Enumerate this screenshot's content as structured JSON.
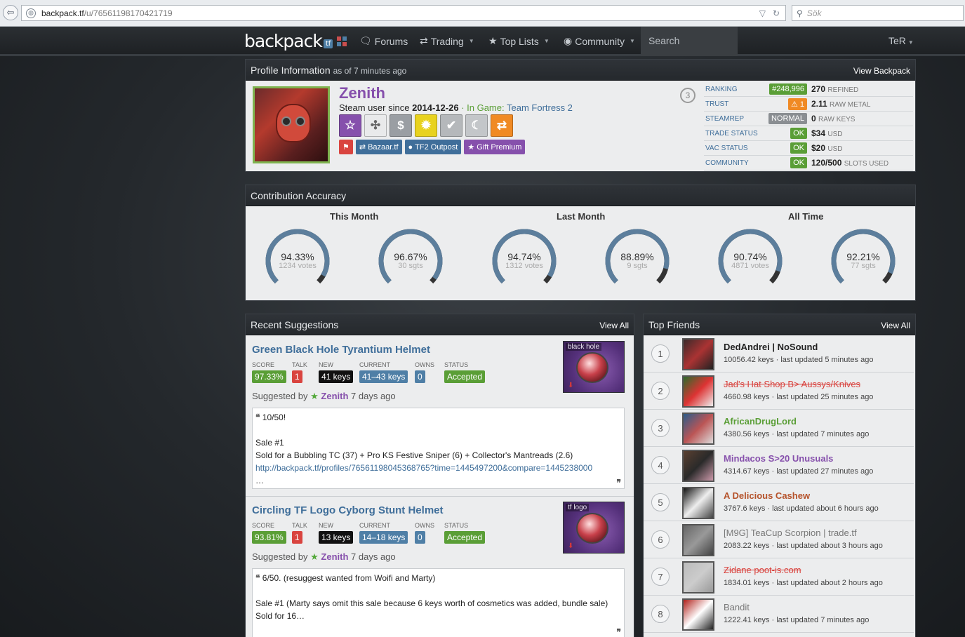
{
  "browser": {
    "url_host": "backpack.tf",
    "url_path": "/u/76561198170421719",
    "search_placeholder": "Sök"
  },
  "nav": {
    "logo": "backpack",
    "logo_badge": "tf",
    "items": [
      {
        "label": "Forums",
        "icon": "comments-icon"
      },
      {
        "label": "Trading",
        "icon": "exchange-icon"
      },
      {
        "label": "Top Lists",
        "icon": "star-icon"
      },
      {
        "label": "Community",
        "icon": "globe-icon"
      }
    ],
    "search": "Search",
    "user": "TeR"
  },
  "profile": {
    "header": "Profile Information",
    "header_sub": "as of 7 minutes ago",
    "view_backpack": "View Backpack",
    "name": "Zenith",
    "since_label": "Steam user since",
    "since_date": "2014-12-26",
    "in_game_label": "· In Game:",
    "game": "Team Fortress 2",
    "badges": [
      {
        "icon": "star-outline-icon",
        "color": "#8650ac",
        "glyph": "☆"
      },
      {
        "icon": "crosshair-icon",
        "color": "#e9eaeb",
        "glyph": "✣"
      },
      {
        "icon": "dollar-icon",
        "color": "#9a9ea3",
        "glyph": "$"
      },
      {
        "icon": "sun-icon",
        "color": "#e8d21f",
        "glyph": "✹"
      },
      {
        "icon": "check-icon",
        "color": "#b5b8bb",
        "glyph": "✔"
      },
      {
        "icon": "moon-icon",
        "color": "#c3c6c9",
        "glyph": "☾"
      },
      {
        "icon": "exchange-icon",
        "color": "#f08a24",
        "glyph": "⇄"
      }
    ],
    "tags": [
      {
        "label": "",
        "icon": "flag-icon",
        "glyph": "⚑",
        "color": "#d9443f"
      },
      {
        "label": "Bazaar.tf",
        "icon": "exchange-icon",
        "glyph": "⇄",
        "color": "#3f6e9a"
      },
      {
        "label": "TF2 Outpost",
        "icon": "circle-icon",
        "glyph": "●",
        "color": "#3f6e9a"
      },
      {
        "label": "Gift Premium",
        "icon": "star-icon",
        "glyph": "★",
        "color": "#8650ac"
      }
    ],
    "rank_circle": "3",
    "stats": [
      {
        "label": "Ranking",
        "badge": "#248,996",
        "badge_color": "#5a9e36",
        "value": "270",
        "unit": "Refined"
      },
      {
        "label": "Trust",
        "badge": "⚠ 1",
        "badge_color": "#f08a24",
        "value": "2.11",
        "unit": "Raw Metal"
      },
      {
        "label": "SteamRep",
        "badge": "NORMAL",
        "badge_color": "#8a8e92",
        "value": "0",
        "unit": "Raw Keys"
      },
      {
        "label": "Trade Status",
        "badge": "OK",
        "badge_color": "#5a9e36",
        "value": "$34",
        "unit": "USD"
      },
      {
        "label": "VAC Status",
        "badge": "OK",
        "badge_color": "#5a9e36",
        "value": "$20",
        "unit": "USD"
      },
      {
        "label": "Community",
        "badge": "OK",
        "badge_color": "#5a9e36",
        "value": "120/500",
        "unit": "Slots Used"
      }
    ]
  },
  "contribution": {
    "header": "Contribution Accuracy",
    "columns": [
      "This Month",
      "Last Month",
      "All Time"
    ],
    "gauges": [
      {
        "pct": "94.33%",
        "value": 94.33,
        "votes": "1234 votes"
      },
      {
        "pct": "96.67%",
        "value": 96.67,
        "votes": "30 sgts"
      },
      {
        "pct": "94.74%",
        "value": 94.74,
        "votes": "1312 votes"
      },
      {
        "pct": "88.89%",
        "value": 88.89,
        "votes": "9 sgts"
      },
      {
        "pct": "90.74%",
        "value": 90.74,
        "votes": "4871 votes"
      },
      {
        "pct": "92.21%",
        "value": 92.21,
        "votes": "77 sgts"
      }
    ]
  },
  "suggestions": {
    "header": "Recent Suggestions",
    "view_all": "View All",
    "meta_headers": [
      "Score",
      "Talk",
      "New",
      "Current",
      "Owns",
      "Status"
    ],
    "suggested_by": "Suggested by",
    "items": [
      {
        "title": "Green Black Hole Tyrantium Helmet",
        "score": "97.33%",
        "talk": "1",
        "new": "41 keys",
        "current": "41–43 keys",
        "owns": "0",
        "status": "Accepted",
        "user": "Zenith",
        "when": "7 days ago",
        "thumb_label": "black hole",
        "quote": [
          "10/50!",
          "",
          "Sale #1",
          "Sold for a Bubbling TC (37) + Pro KS Festive Sniper (6) + Collector's Mantreads (2.6)"
        ],
        "quote_url": "http://backpack.tf/profiles/76561198045368765?time=1445497200&compare=1445238000",
        "quote_more": "…"
      },
      {
        "title": "Circling TF Logo Cyborg Stunt Helmet",
        "score": "93.81%",
        "talk": "1",
        "new": "13 keys",
        "current": "14–18 keys",
        "owns": "0",
        "status": "Accepted",
        "user": "Zenith",
        "when": "7 days ago",
        "thumb_label": "tf logo",
        "quote": [
          "6/50. (resuggest wanted from Woifi and Marty)",
          "",
          "Sale #1 (Marty says omit this sale because 6 keys worth of cosmetics was added, bundle sale)",
          "Sold for 16…"
        ],
        "quote_url": "",
        "quote_more": ""
      }
    ]
  },
  "friends": {
    "header": "Top Friends",
    "view_all": "View All",
    "items": [
      {
        "rank": "1",
        "name": "DedAndrei | NoSound",
        "color": "#222",
        "strike": false,
        "keys": "10056.42 keys",
        "updated": "last updated 5 minutes ago",
        "av": [
          "#3b2a2a",
          "#a33",
          "#222"
        ]
      },
      {
        "rank": "2",
        "name": "Jad's Hat Shop B> Aussys/Knives",
        "color": "#d9443f",
        "strike": true,
        "keys": "4660.98 keys",
        "updated": "last updated 25 minutes ago",
        "av": [
          "#2b6b2b",
          "#d33",
          "#eee"
        ]
      },
      {
        "rank": "3",
        "name": "AfricanDrugLord",
        "color": "#5a9e36",
        "strike": false,
        "keys": "4380.56 keys",
        "updated": "last updated 7 minutes ago",
        "av": [
          "#2a5c8a",
          "#b55",
          "#ddd"
        ]
      },
      {
        "rank": "4",
        "name": "Mindacos S>20 Unusuals",
        "color": "#8650ac",
        "strike": false,
        "keys": "4314.67 keys",
        "updated": "last updated 27 minutes ago",
        "av": [
          "#5a4030",
          "#2a2a2a",
          "#c9a"
        ]
      },
      {
        "rank": "5",
        "name": "A Delicious Cashew",
        "color": "#b5522a",
        "strike": false,
        "keys": "3767.6 keys",
        "updated": "last updated about 6 hours ago",
        "av": [
          "#111",
          "#eee",
          "#444"
        ]
      },
      {
        "rank": "6",
        "name": "[M9G] TeaCup Scorpion | trade.tf",
        "color": "#777",
        "strike": false,
        "keys": "2083.22 keys",
        "updated": "last updated about 3 hours ago",
        "av": [
          "#666",
          "#999",
          "#444"
        ]
      },
      {
        "rank": "7",
        "name": "Zidane poot-is.com",
        "color": "#d9443f",
        "strike": true,
        "keys": "1834.01 keys",
        "updated": "last updated about 2 hours ago",
        "av": [
          "#bbb",
          "#ccc",
          "#999"
        ]
      },
      {
        "rank": "8",
        "name": "Bandit",
        "color": "#777",
        "strike": false,
        "keys": "1222.41 keys",
        "updated": "last updated 7 minutes ago",
        "av": [
          "#b0201a",
          "#fff",
          "#222"
        ]
      }
    ]
  }
}
